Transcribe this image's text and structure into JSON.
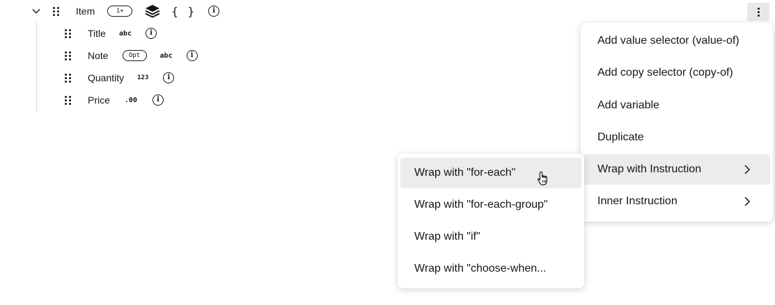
{
  "tree": {
    "parent": {
      "label": "Item",
      "cardinality": "1+",
      "braces": "{ }",
      "info": "i"
    },
    "children": [
      {
        "label": "Title",
        "optional": "",
        "type": "abc"
      },
      {
        "label": "Note",
        "optional": "Opt",
        "type": "abc"
      },
      {
        "label": "Quantity",
        "optional": "",
        "type": "123"
      },
      {
        "label": "Price",
        "optional": "",
        "type": ".00"
      }
    ]
  },
  "context_menu": {
    "items": [
      {
        "label": "Add value selector (value-of)"
      },
      {
        "label": "Add copy selector (copy-of)"
      },
      {
        "label": "Add variable"
      },
      {
        "label": "Duplicate"
      },
      {
        "label": "Wrap with Instruction",
        "has_submenu": true,
        "highlighted": true
      },
      {
        "label": "Inner Instruction",
        "has_submenu": true
      }
    ]
  },
  "submenu": {
    "items": [
      {
        "label": "Wrap with \"for-each\"",
        "highlighted": true
      },
      {
        "label": "Wrap with \"for-each-group\""
      },
      {
        "label": "Wrap with \"if\""
      },
      {
        "label": "Wrap with \"choose-when..."
      }
    ]
  },
  "colors": {
    "text": "#161616",
    "highlight": "#ececec",
    "kebab_bg": "#e8e8e8",
    "tree_line": "#d9d9d9"
  }
}
